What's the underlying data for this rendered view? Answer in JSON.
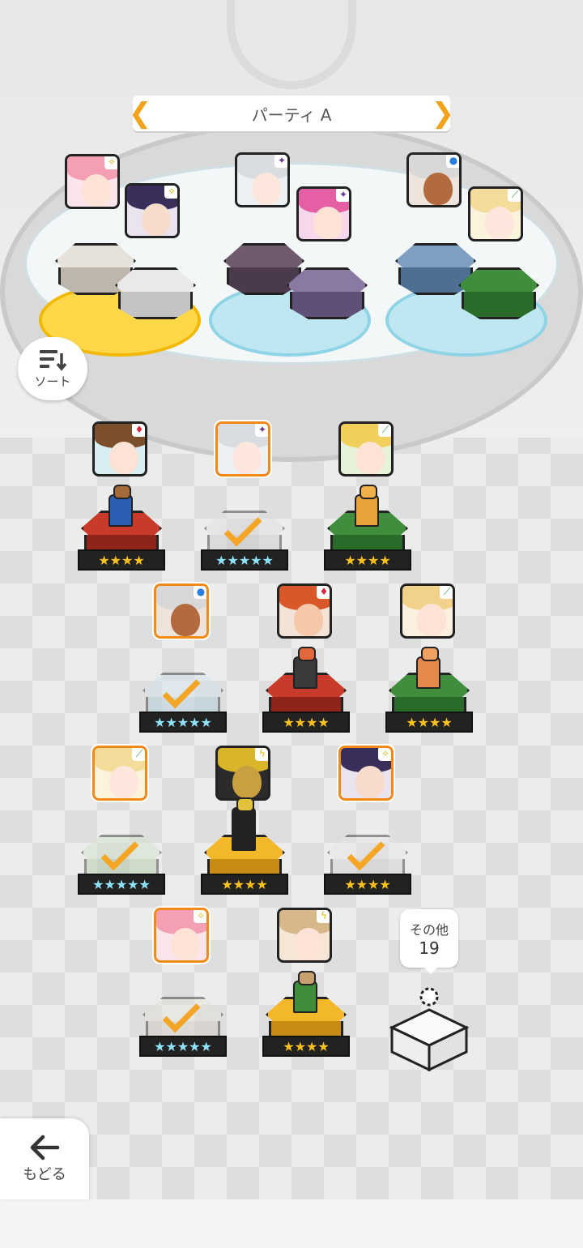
{
  "party": {
    "title": "パーティ A"
  },
  "controls": {
    "sort_label": "ソート",
    "back_label": "もどる"
  },
  "others": {
    "label": "その他",
    "count": "19"
  },
  "colors": {
    "accent": "#f08a1a",
    "star": "#ffc21a",
    "rainbow_star": "#8fe3ff"
  },
  "party_members": [
    {
      "element": "light-icon"
    },
    {
      "element": "light-icon"
    },
    {
      "element": "dark-icon"
    },
    {
      "element": "dark-icon"
    },
    {
      "element": "water-icon"
    },
    {
      "element": "wind-icon"
    }
  ],
  "roster": [
    {
      "stars": "★★★★",
      "element": "fire-icon",
      "selected": false
    },
    {
      "stars": "★★★★★",
      "element": "dark-icon",
      "selected": true
    },
    {
      "stars": "★★★★",
      "element": "wind-icon",
      "selected": false
    },
    {
      "stars": "★★★★★",
      "element": "water-icon",
      "selected": true
    },
    {
      "stars": "★★★★",
      "element": "fire-icon",
      "selected": false
    },
    {
      "stars": "★★★★",
      "element": "wind-icon",
      "selected": false
    },
    {
      "stars": "★★★★★",
      "element": "wind-icon",
      "selected": true
    },
    {
      "stars": "★★★★",
      "element": "thunder-icon",
      "selected": false
    },
    {
      "stars": "★★★★",
      "element": "light-icon",
      "selected": true
    },
    {
      "stars": "★★★★★",
      "element": "light-icon",
      "selected": true
    },
    {
      "stars": "★★★★",
      "element": "thunder-icon",
      "selected": false
    }
  ]
}
